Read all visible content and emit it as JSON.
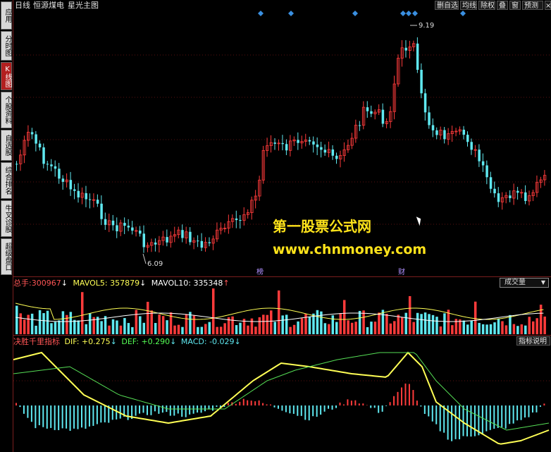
{
  "sidebar": {
    "tabs": [
      {
        "label": "应用",
        "active": false
      },
      {
        "label": "分时图",
        "active": false
      },
      {
        "label": "K线图",
        "active": true
      },
      {
        "label": "个股资料",
        "active": false
      },
      {
        "label": "自选股",
        "active": false
      },
      {
        "label": "综合排名",
        "active": false
      },
      {
        "label": "牛叉诊股",
        "active": false
      },
      {
        "label": "超级盘口",
        "active": false
      }
    ]
  },
  "header": {
    "period": "日线",
    "stock_name": "恒源煤电",
    "indicator": "星光主图"
  },
  "toolbar": {
    "buttons": [
      "删自选",
      "均线",
      "除权",
      "叠",
      "窗",
      "预测"
    ]
  },
  "main_chart": {
    "high_label": "9.19",
    "low_label": "6.09",
    "event_markers": [
      "榜",
      "财"
    ],
    "colors": {
      "up": "#ff3b3b",
      "down": "#5fe8f0",
      "marker": "#3a8fe0",
      "event": "#b090ff"
    }
  },
  "volume_panel": {
    "label_total": "总手:",
    "total_value": "300967",
    "total_arrow": "↓",
    "ma5_label": "MAVOL5:",
    "ma5_value": "357879",
    "ma5_arrow": "↓",
    "ma10_label": "MAVOL10:",
    "ma10_value": "335348",
    "ma10_arrow": "↑",
    "selector": "成交量"
  },
  "macd_panel": {
    "name": "决胜千里指标",
    "dif_label": "DIF:",
    "dif_value": "+0.275",
    "dif_arrow": "↓",
    "def_label": "DEF:",
    "def_value": "+0.290",
    "def_arrow": "↓",
    "macd_label": "MACD:",
    "macd_value": "-0.029",
    "macd_arrow": "↓",
    "help_button": "指标说明"
  },
  "watermark": {
    "title": "第一股票公式网",
    "url": "www.chnmoney.com"
  }
}
